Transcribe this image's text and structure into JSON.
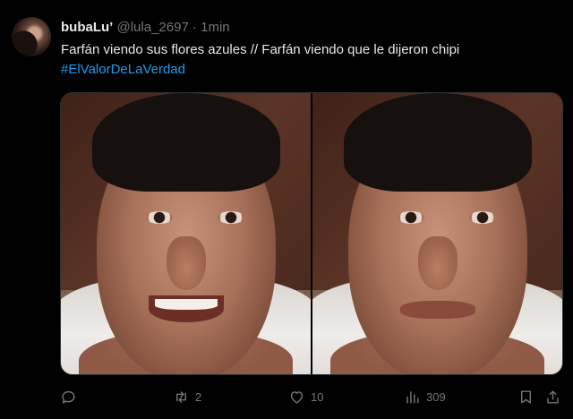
{
  "tweet": {
    "author": {
      "display_name": "bubaLu’",
      "handle": "@lula_2697",
      "separator": "·",
      "time": "1min"
    },
    "text": "Farfán viendo sus flores azules // Farfán viendo que le dijeron chipi",
    "hashtag": "#ElValorDeLaVerdad",
    "media": [
      {
        "name": "photo-smiling-man"
      },
      {
        "name": "photo-sad-man"
      }
    ]
  },
  "actions": {
    "reply": {
      "icon": "reply-icon",
      "count": ""
    },
    "retweet": {
      "icon": "retweet-icon",
      "count": "2"
    },
    "like": {
      "icon": "heart-icon",
      "count": "10"
    },
    "views": {
      "icon": "views-chart-icon",
      "count": "309"
    },
    "bookmark": {
      "icon": "bookmark-icon"
    },
    "share": {
      "icon": "share-icon"
    }
  },
  "colors": {
    "background": "#000000",
    "text_primary": "#e7e9ea",
    "text_secondary": "#71767b",
    "link": "#1d9bf0"
  }
}
